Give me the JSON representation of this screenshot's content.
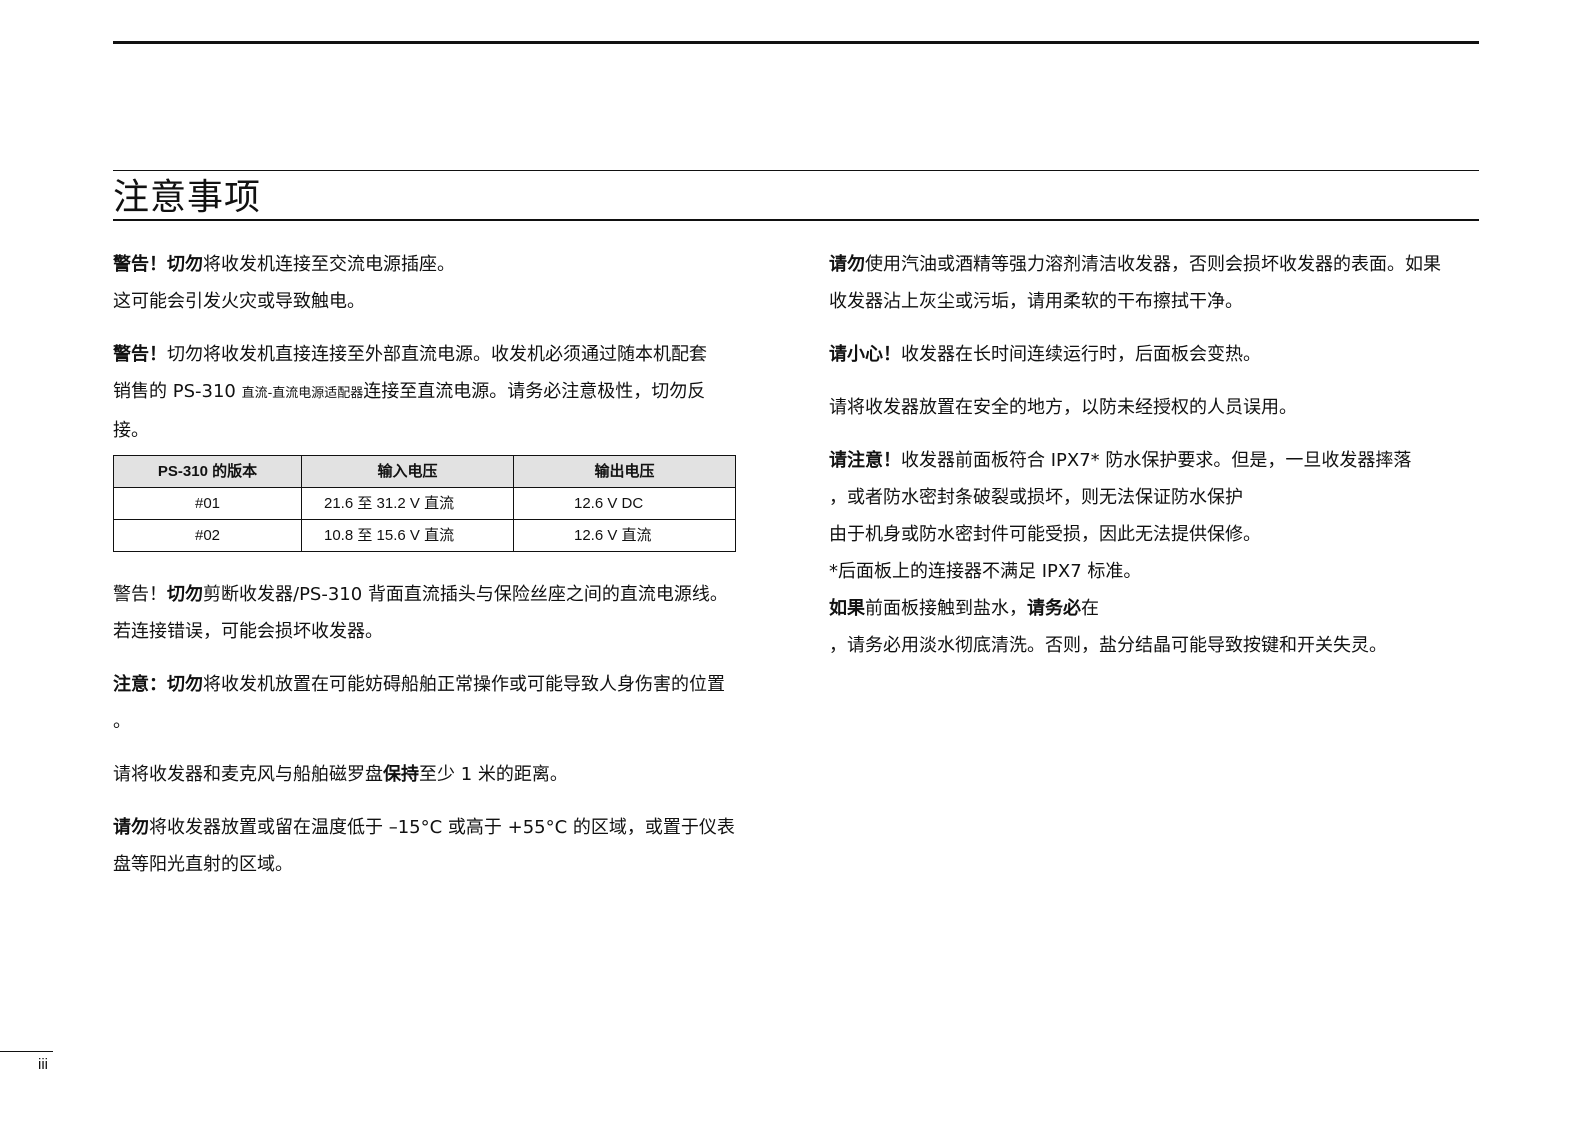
{
  "page": {
    "title": "注意事项",
    "page_number": "iii"
  },
  "left": {
    "p1": {
      "l1_b": "警告！切勿",
      "l1": "将收发机连接至交流电源插座。",
      "l2": "这可能会引发火灾或导致触电。"
    },
    "p2": {
      "l1_b": "警告！",
      "l1": "切勿将收发机直接连接至外部直流电源。收发机必须通过随本机配套",
      "l2a": "销售的 PS-310 ",
      "l2_small": "直流-直流电源适配器",
      "l2b": "连接至直流电源。请务必注意极性，切勿反",
      "l3": "接。"
    },
    "table": {
      "headers": [
        "PS-310 的版本",
        "输入电压",
        "输出电压"
      ],
      "rows": [
        [
          "#01",
          "21.6 至 31.2 V 直流",
          "12.6 V DC"
        ],
        [
          "#02",
          "10.8 至 15.6 V 直流",
          "12.6 V 直流"
        ]
      ]
    },
    "p3": {
      "l1_pre": "警告！",
      "l1_b": "切勿",
      "l1": "剪断收发器/PS-310 背面直流插头与保险丝座之间的直流电源线。",
      "l2": "若连接错误，可能会损坏收发器。"
    },
    "p4": {
      "l1_pre": "注意：",
      "l1_b": "切勿",
      "l1": "将收发机放置在可能妨碍船舶正常操作或可能导致人身伤害的位置",
      "l2": "。"
    },
    "p5": {
      "l1a": "请将收发器和麦克风与船舶磁罗盘",
      "l1_b": "保持",
      "l1b": "至少 1 米的距离。"
    },
    "p6": {
      "l1_b": "请勿",
      "l1": "将收发器放置或留在温度低于 –15°C 或高于 +55°C 的区域，或置于仪表",
      "l2": "盘等阳光直射的区域。"
    }
  },
  "right": {
    "p1": {
      "l1_b": "请勿",
      "l1": "使用汽油或酒精等强力溶剂清洁收发器，否则会损坏收发器的表面。如果",
      "l2": "收发器沾上灰尘或污垢，请用柔软的干布擦拭干净。"
    },
    "p2": {
      "l1_b": "请小心！",
      "l1": "收发器在长时间连续运行时，后面板会变热。"
    },
    "p3": {
      "l1": "请将收发器放置在安全的地方，以防未经授权的人员误用。"
    },
    "p4": {
      "l1_b": "请注意！",
      "l1": "收发器前面板符合 IPX7* 防水保护要求。但是，一旦收发器摔落",
      "l2": "，或者防水密封条破裂或损坏，则无法保证防水保护",
      "l3": "由于机身或防水密封件可能受损，因此无法提供保修。",
      "l4": "*后面板上的连接器不满足 IPX7 标准。",
      "l5_b1": "如果",
      "l5a": "前面板接触到盐水，",
      "l5_b2": "请务必",
      "l5b": "在",
      "l6": "，请务必用淡水彻底清洗。否则，盐分结晶可能导致按键和开关失灵。"
    }
  }
}
